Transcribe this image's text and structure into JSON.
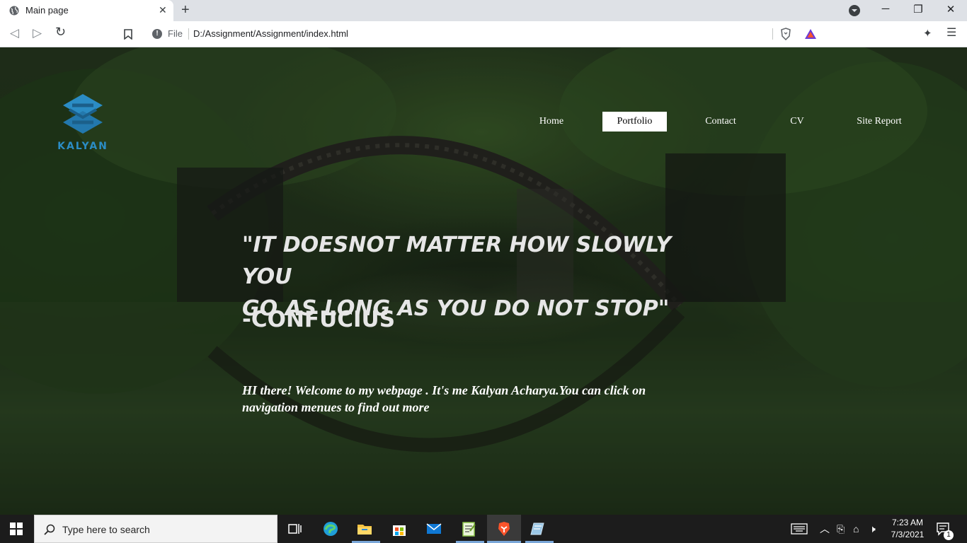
{
  "browser": {
    "tab": {
      "title": "Main page",
      "favicon": "globe-icon"
    },
    "address": {
      "scheme": "File",
      "url": "D:/Assignment/Assignment/index.html"
    }
  },
  "site": {
    "logo_text": "KALYAN",
    "nav": [
      {
        "label": "Home",
        "active": false
      },
      {
        "label": "Portfolio",
        "active": true
      },
      {
        "label": "Contact",
        "active": false
      },
      {
        "label": "CV",
        "active": false
      },
      {
        "label": "Site Report",
        "active": false
      }
    ],
    "quote_line1": "\"IT DOESNOT MATTER HOW SLOWLY YOU",
    "quote_line2": "GO AS LONG AS YOU DO NOT STOP\"",
    "author": "-CONFUCIUS",
    "welcome": "HI there! Welcome to my webpage . It's me Kalyan Acharya.You can click on navigation menues to find out more"
  },
  "taskbar": {
    "search_placeholder": "Type here to search",
    "time": "7:23 AM",
    "date": "7/3/2021",
    "notification_count": "1"
  },
  "colors": {
    "logo_blue": "#2b8cc4",
    "taskbar_bg": "#1c1c1c",
    "tab_strip": "#dee1e6"
  }
}
